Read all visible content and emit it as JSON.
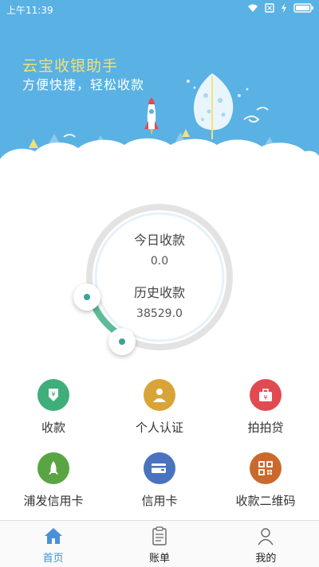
{
  "status_bar": {
    "time": "上午11:39"
  },
  "brand": {
    "title": "云宝收银助手",
    "subtitle": "方便快捷，轻松收款"
  },
  "summary": {
    "today_label": "今日收款",
    "today_value": "0.0",
    "history_label": "历史收款",
    "history_value": "38529.0"
  },
  "grid": [
    {
      "label": "收款",
      "icon": "yuan-download-icon",
      "color": "#3fae7b"
    },
    {
      "label": "个人认证",
      "icon": "person-icon",
      "color": "#d8a437"
    },
    {
      "label": "拍拍贷",
      "icon": "briefcase-yuan-icon",
      "color": "#e24a52"
    },
    {
      "label": "浦发信用卡",
      "icon": "rocket-icon",
      "color": "#59a544"
    },
    {
      "label": "信用卡",
      "icon": "credit-card-icon",
      "color": "#4a73bf"
    },
    {
      "label": "收款二维码",
      "icon": "qr-code-icon",
      "color": "#c96a2c"
    }
  ],
  "nav": [
    {
      "label": "首页",
      "icon": "home-icon",
      "active": true
    },
    {
      "label": "账单",
      "icon": "clipboard-icon",
      "active": false
    },
    {
      "label": "我的",
      "icon": "user-icon",
      "active": false
    }
  ],
  "colors": {
    "header": "#5ab1e3",
    "accent": "#3f8fd1",
    "gauge_progress": "#5dbb97"
  }
}
